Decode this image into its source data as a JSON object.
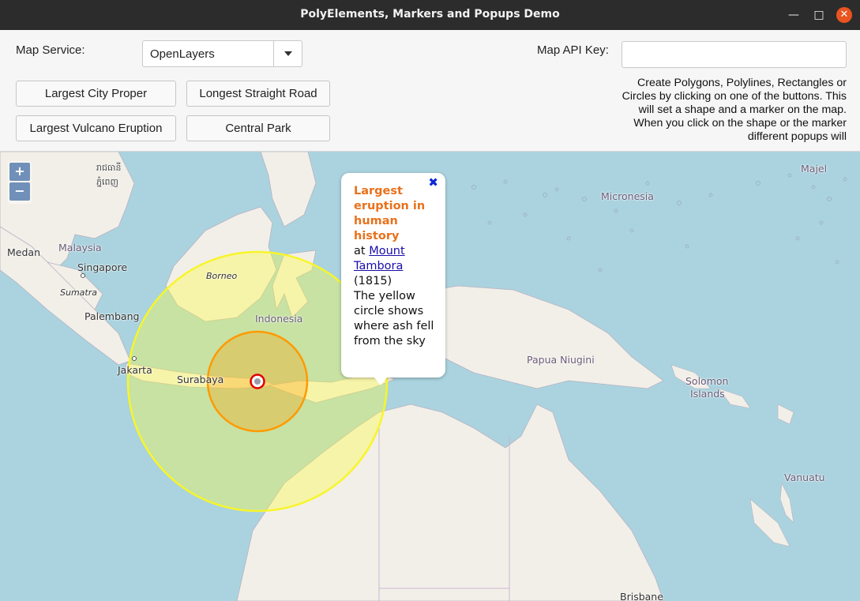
{
  "window": {
    "title": "PolyElements, Markers and Popups Demo"
  },
  "toolbar": {
    "map_service_label": "Map Service:",
    "map_service_value": "OpenLayers",
    "api_key_label": "Map API Key:",
    "api_key_value": "",
    "buttons": {
      "city": "Largest City Proper",
      "road": "Longest Straight Road",
      "vulcano": "Largest Vulcano Eruption",
      "park": "Central Park"
    },
    "help_text": "Create Polygons, Polylines, Rectangles or Circles by clicking on one of the buttons. This will set a shape and a marker on the map. When you click on the shape or the marker different popups will"
  },
  "map": {
    "zoom_in": "+",
    "zoom_out": "−",
    "labels": {
      "majel": "Majel",
      "micronesia": "Micronesia",
      "medan": "Medan",
      "malaysia": "Malaysia",
      "singapore": "Singapore",
      "sumatra": "Sumatra",
      "borneo": "Borneo",
      "palembang": "Palembang",
      "indonesia": "Indonesia",
      "jakarta": "Jakarta",
      "surabaya": "Surabaya",
      "papua": "Papua Niugini",
      "solomon1": "Solomon",
      "solomon2": "Islands",
      "vanuatu": "Vanuatu",
      "brisbane": "Brisbane",
      "khmer1": "រាជធានី",
      "khmer2": "ភ្នំពេញ"
    },
    "colors": {
      "outer_circle": "#ffff33",
      "inner_circle": "#ff9900",
      "marker": "#ff0000",
      "water": "#aad3df",
      "land": "#f2efe9"
    }
  },
  "popup": {
    "close": "✖",
    "title": "Largest eruption in human history",
    "at": "at ",
    "link": "Mount Tambora",
    "year": "(1815)",
    "body": "The yellow circle shows where ash fell from the sky"
  }
}
